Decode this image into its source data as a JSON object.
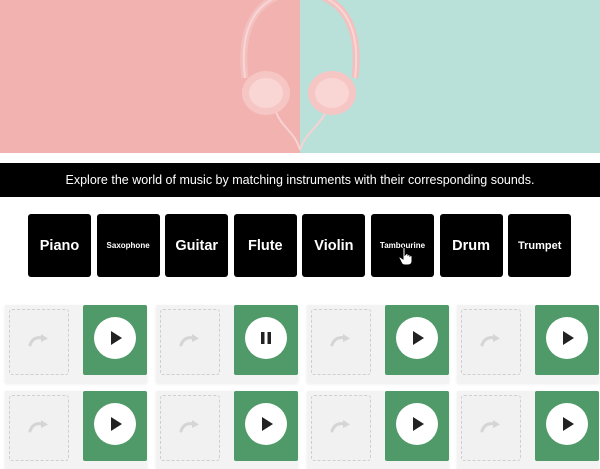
{
  "banner": {
    "text": "Explore the world of music by matching instruments with their corresponding sounds."
  },
  "instruments": [
    {
      "label": "Piano",
      "size": "big"
    },
    {
      "label": "Saxophone",
      "size": "small"
    },
    {
      "label": "Guitar",
      "size": "big"
    },
    {
      "label": "Flute",
      "size": "big"
    },
    {
      "label": "Violin",
      "size": "big"
    },
    {
      "label": "Tambourine",
      "size": "small"
    },
    {
      "label": "Drum",
      "size": "big"
    },
    {
      "label": "Trumpet",
      "size": "mid"
    }
  ],
  "cards": [
    {
      "state": "play"
    },
    {
      "state": "pause"
    },
    {
      "state": "play"
    },
    {
      "state": "play"
    },
    {
      "state": "play"
    },
    {
      "state": "play"
    },
    {
      "state": "play"
    },
    {
      "state": "play"
    }
  ],
  "colors": {
    "banner": "#000000",
    "sound_tile": "#4f9a68",
    "hero_left": "#f2b2b0",
    "hero_right": "#b9e0d9"
  },
  "icons": {
    "slot": "redo-arrow-icon",
    "play": "play-icon",
    "pause": "pause-icon",
    "cursor": "hand-pointer-icon"
  }
}
